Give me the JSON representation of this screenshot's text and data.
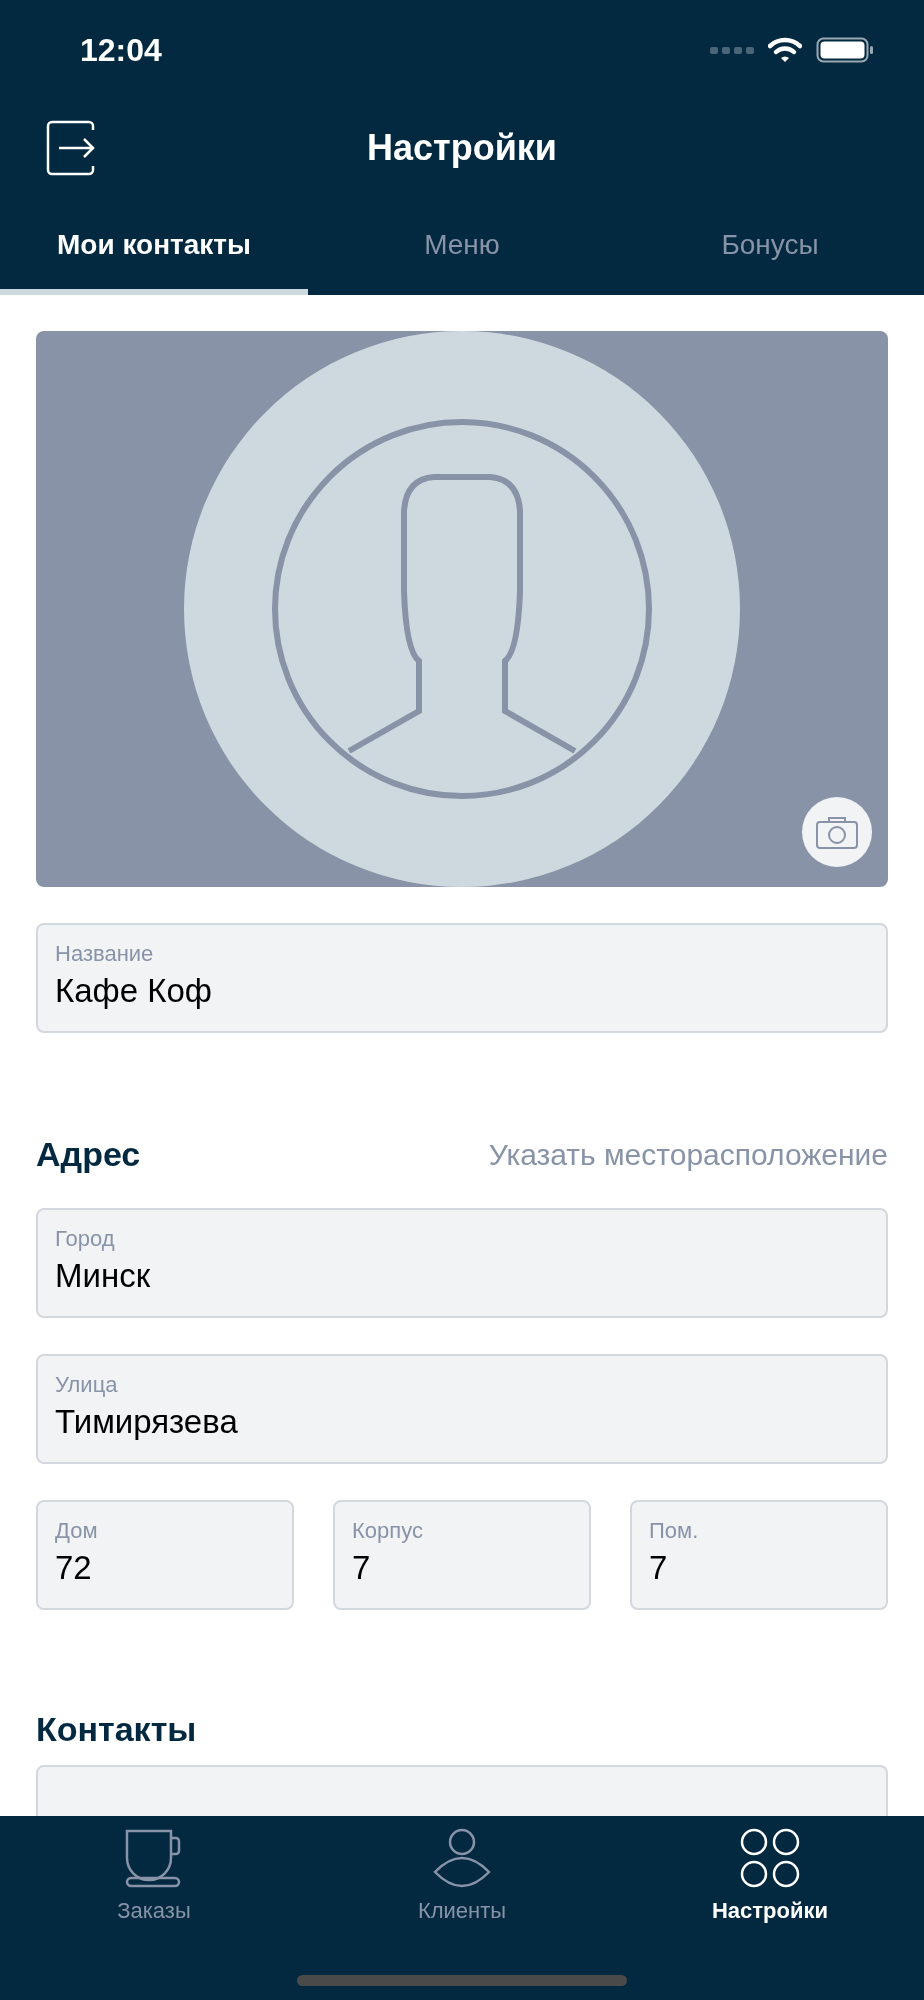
{
  "status_bar": {
    "time": "12:04"
  },
  "nav_bar": {
    "title": "Настройки"
  },
  "tabs": [
    {
      "label": "Мои контакты",
      "selected": true
    },
    {
      "label": "Меню",
      "selected": false
    },
    {
      "label": "Бонусы",
      "selected": false
    }
  ],
  "name_field": {
    "label": "Название",
    "value": "Кафе Коф"
  },
  "address": {
    "title": "Адрес",
    "link": "Указать месторасположение",
    "fields": [
      {
        "label": "Город",
        "value": "Минск"
      },
      {
        "label": "Улица",
        "value": "Тимирязева"
      }
    ],
    "small_fields": [
      {
        "label": "Дом",
        "value": "72"
      },
      {
        "label": "Корпус",
        "value": "7"
      },
      {
        "label": "Пом.",
        "value": "7"
      }
    ]
  },
  "contacts": {
    "title": "Контакты"
  },
  "bottom_tabs": [
    {
      "label": "Заказы",
      "kind": "cup",
      "selected": false
    },
    {
      "label": "Клиенты",
      "kind": "person",
      "selected": false
    },
    {
      "label": "Настройки",
      "kind": "circles",
      "selected": true
    }
  ]
}
